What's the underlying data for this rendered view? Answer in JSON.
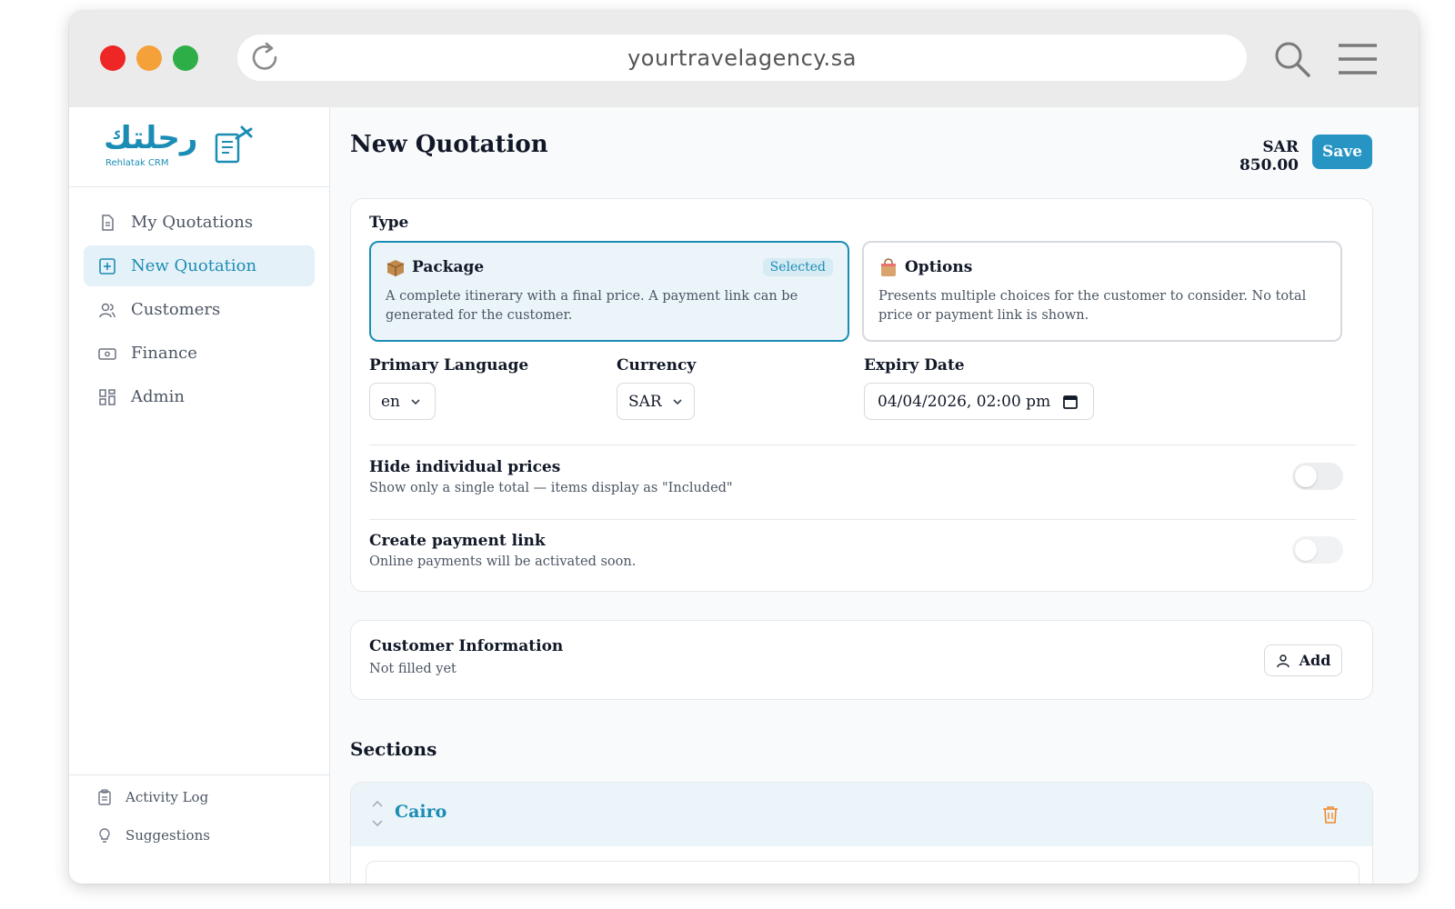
{
  "browser": {
    "url": "yourtravelagency.sa"
  },
  "logo": {
    "arabic": "رحلتك",
    "english": "Rehlatak CRM"
  },
  "sidebar": {
    "items": [
      {
        "label": "My Quotations",
        "icon": "document-icon"
      },
      {
        "label": "New Quotation",
        "icon": "plus-square-icon"
      },
      {
        "label": "Customers",
        "icon": "users-icon"
      },
      {
        "label": "Finance",
        "icon": "money-icon"
      },
      {
        "label": "Admin",
        "icon": "grid-icon"
      }
    ],
    "bottom": [
      {
        "label": "Activity Log",
        "icon": "clipboard-icon"
      },
      {
        "label": "Suggestions",
        "icon": "lightbulb-icon"
      }
    ]
  },
  "header": {
    "title": "New Quotation",
    "total": "SAR 850.00",
    "save_label": "Save"
  },
  "type_card": {
    "label": "Type",
    "options": [
      {
        "title": "Package",
        "desc": "A complete itinerary with a final price. A payment link can be generated for the customer.",
        "badge": "Selected",
        "icon": "package-icon"
      },
      {
        "title": "Options",
        "desc": "Presents multiple choices for the customer to consider. No total price or payment link is shown.",
        "icon": "shopping-bag-icon"
      }
    ],
    "language": {
      "label": "Primary Language",
      "value": "en"
    },
    "currency": {
      "label": "Currency",
      "value": "SAR"
    },
    "expiry": {
      "label": "Expiry Date",
      "value": "04/04/2026, 02:00 pm"
    },
    "hide_prices": {
      "title": "Hide individual prices",
      "sub": "Show only a single total — items display as \"Included\""
    },
    "payment_link": {
      "title": "Create payment link",
      "sub": "Online payments will be activated soon."
    }
  },
  "customer": {
    "title": "Customer Information",
    "sub": "Not filled yet",
    "add_label": "Add"
  },
  "sections": {
    "title": "Sections",
    "items": [
      {
        "name": "Cairo"
      }
    ]
  },
  "colors": {
    "accent": "#1b8db5",
    "save": "#2795c4",
    "trash": "#f08a2c"
  }
}
